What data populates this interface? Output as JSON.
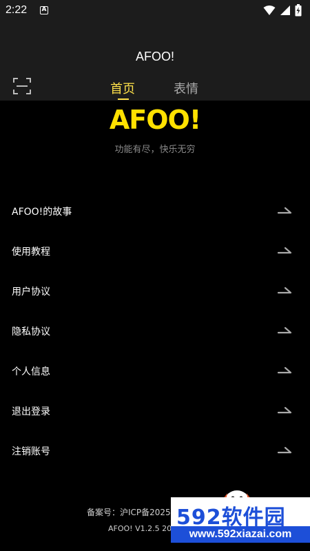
{
  "status_bar": {
    "time": "2:22",
    "notification_icon": "A"
  },
  "header": {
    "title": "AFOO!",
    "tabs": [
      {
        "label": "首页",
        "active": true
      },
      {
        "label": "表情",
        "active": false
      }
    ]
  },
  "brand": {
    "logo_text": "AFOO!",
    "slogan": "功能有尽，快乐无穷"
  },
  "menu": {
    "items": [
      {
        "label": "AFOO!的故事"
      },
      {
        "label": "使用教程"
      },
      {
        "label": "用户协议"
      },
      {
        "label": "隐私协议"
      },
      {
        "label": "个人信息"
      },
      {
        "label": "退出登录"
      },
      {
        "label": "注销账号"
      }
    ]
  },
  "footer": {
    "icp": "备案号：沪ICP备20251",
    "version": "AFOO! V1.2.5 202"
  },
  "watermark": {
    "brand": "592软件园",
    "url": "www.592xiazai.com"
  },
  "colors": {
    "accent": "#ffe14a",
    "background": "#000000",
    "header_bg": "#1c1c1c",
    "watermark_blue": "#1d4fd8"
  }
}
